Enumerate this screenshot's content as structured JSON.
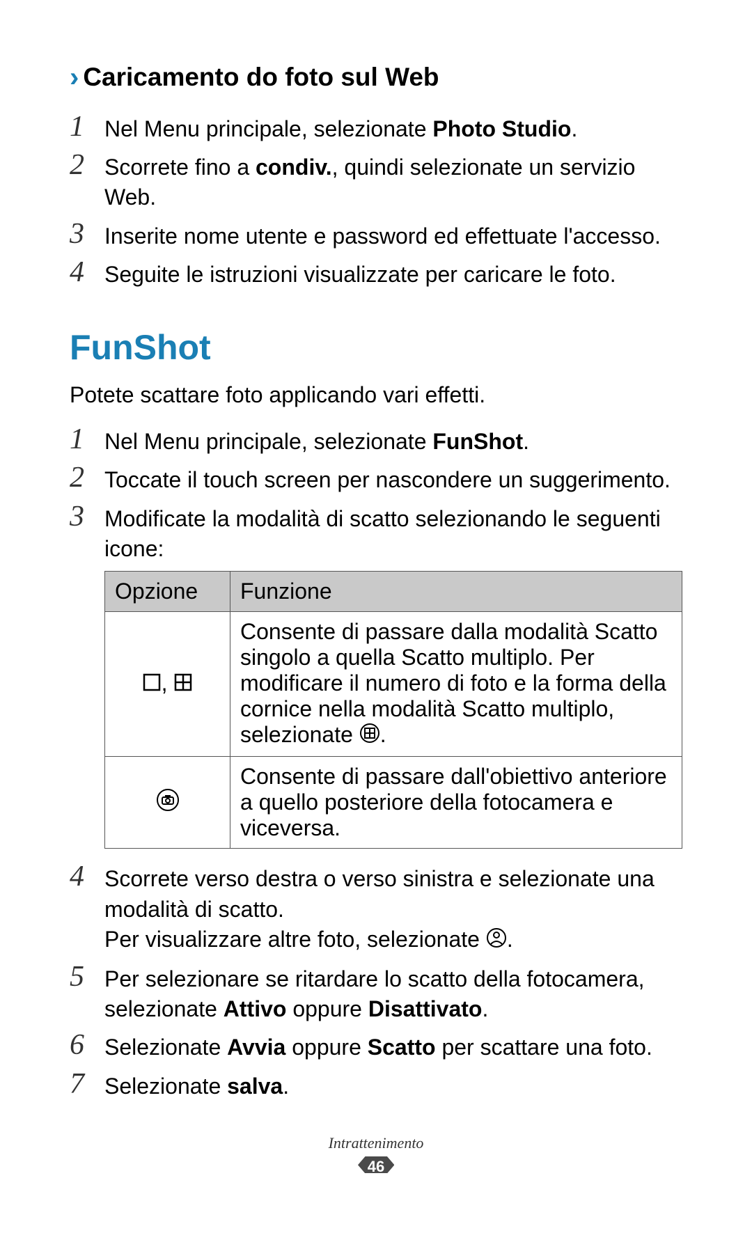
{
  "section1": {
    "heading": "Caricamento do foto sul Web",
    "steps": [
      {
        "pre": "Nel Menu principale, selezionate ",
        "bold": "Photo Studio",
        "post": "."
      },
      {
        "pre": "Scorrete fino a ",
        "bold": "condiv.",
        "post": ", quindi selezionate un servizio Web."
      },
      {
        "pre": "Inserite nome utente e password ed effettuate l'accesso.",
        "bold": "",
        "post": ""
      },
      {
        "pre": "Seguite le istruzioni visualizzate per caricare le foto.",
        "bold": "",
        "post": ""
      }
    ]
  },
  "section2": {
    "heading": "FunShot",
    "intro": "Potete scattare foto applicando vari effetti.",
    "steps123": [
      {
        "pre": "Nel Menu principale, selezionate ",
        "bold": "FunShot",
        "post": "."
      },
      {
        "pre": "Toccate il touch screen per nascondere un suggerimento.",
        "bold": "",
        "post": ""
      },
      {
        "pre": "Modificate la modalità di scatto selezionando le seguenti icone:",
        "bold": "",
        "post": ""
      }
    ],
    "table": {
      "headers": {
        "opt": "Opzione",
        "fun": "Funzione"
      },
      "row1": "Consente di passare dalla modalità Scatto singolo a quella Scatto multiplo. Per modificare il numero di foto e la forma della cornice nella modalità Scatto multiplo, selezionate ",
      "row1_post": ".",
      "row2": "Consente di passare dall'obiettivo anteriore a quello posteriore della fotocamera e viceversa."
    },
    "step4": {
      "line1": "Scorrete verso destra o verso sinistra e selezionate una modalità di scatto.",
      "line2_pre": "Per visualizzare altre foto, selezionate ",
      "line2_post": "."
    },
    "step5": {
      "pre": "Per selezionare se ritardare lo scatto della fotocamera, selezionate ",
      "bold1": "Attivo",
      "mid": " oppure ",
      "bold2": "Disattivato",
      "post": "."
    },
    "step6": {
      "pre": "Selezionate ",
      "bold1": "Avvia",
      "mid": " oppure ",
      "bold2": "Scatto",
      "post": " per scattare una foto."
    },
    "step7": {
      "pre": "Selezionate ",
      "bold": "salva",
      "post": "."
    }
  },
  "footer": {
    "section_name": "Intrattenimento",
    "page_number": "46"
  },
  "nums": {
    "n1": "1",
    "n2": "2",
    "n3": "3",
    "n4": "4",
    "n5": "5",
    "n6": "6",
    "n7": "7"
  }
}
